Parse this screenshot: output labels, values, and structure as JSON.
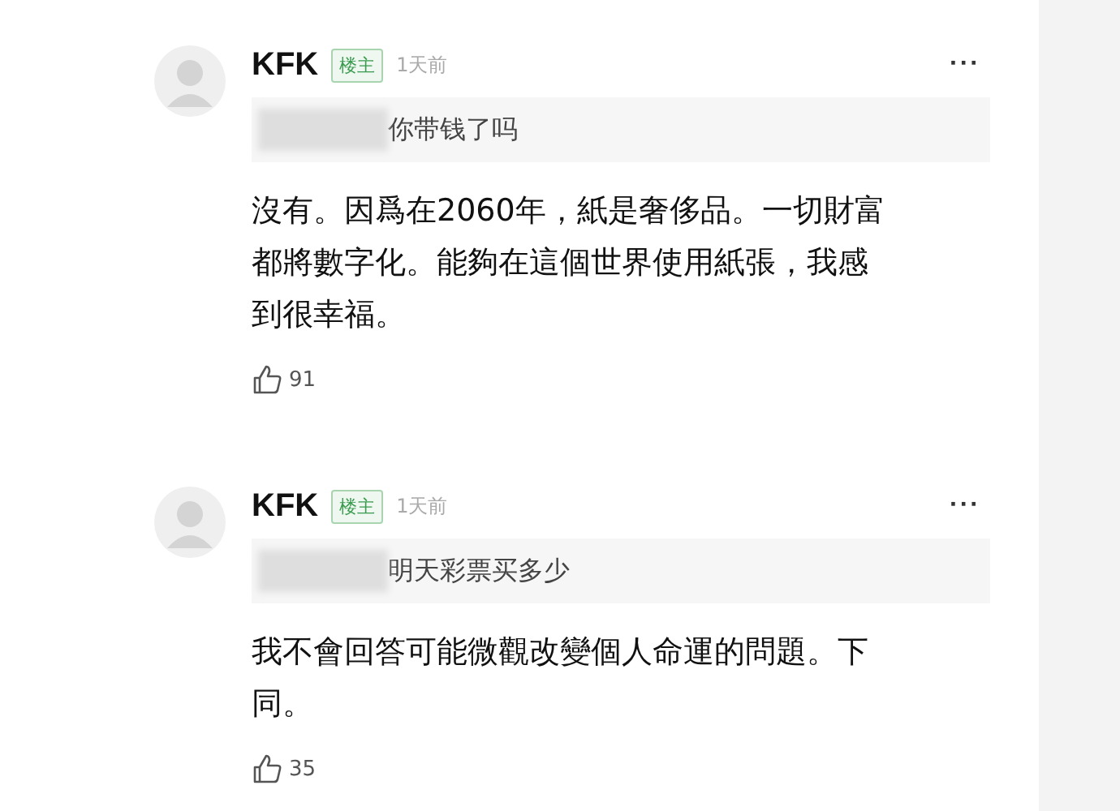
{
  "comments": [
    {
      "author": "KFK",
      "badge": "楼主",
      "time": "1天前",
      "more": "···",
      "quote": "你带钱了吗",
      "body": "沒有。因爲在2060年，紙是奢侈品。一切財富都將數字化。能夠在這個世界使用紙張，我感到很幸福。",
      "likes": "91"
    },
    {
      "author": "KFK",
      "badge": "楼主",
      "time": "1天前",
      "more": "···",
      "quote": "明天彩票买多少",
      "body": "我不會回答可能微觀改變個人命運的問題。下同。",
      "likes": "35"
    }
  ]
}
